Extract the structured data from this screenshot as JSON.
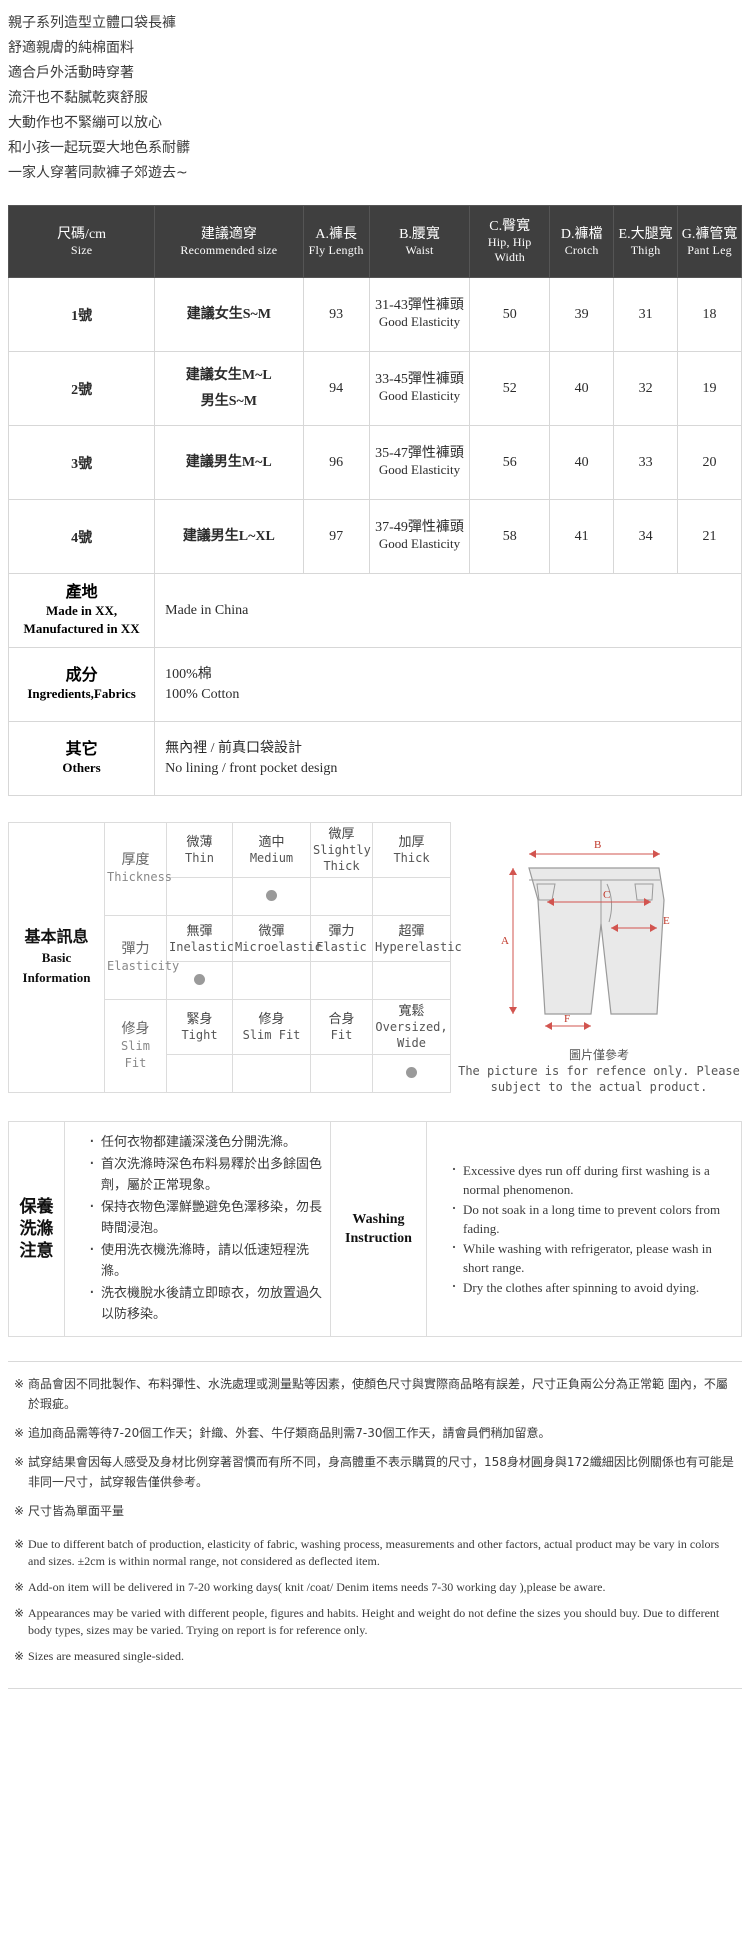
{
  "intro": {
    "lines": [
      "親子系列造型立體口袋長褲",
      "舒適親膚的純棉面料",
      "適合戶外活動時穿著",
      "流汗也不黏膩乾爽舒服",
      "大動作也不緊繃可以放心",
      "和小孩一起玩耍大地色系耐髒",
      "一家人穿著同款褲子郊遊去~"
    ]
  },
  "size_table": {
    "headers": [
      {
        "cn": "尺碼/cm",
        "en": "Size"
      },
      {
        "cn": "建議適穿",
        "en": "Recommended size"
      },
      {
        "cn": "A.褲長",
        "en": "Fly Length"
      },
      {
        "cn": "B.腰寬",
        "en": "Waist"
      },
      {
        "cn": "C.臀寬",
        "en": "Hip, Hip Width"
      },
      {
        "cn": "D.褲檔",
        "en": "Crotch"
      },
      {
        "cn": "E.大腿寬",
        "en": "Thigh"
      },
      {
        "cn": "G.褲管寬",
        "en": "Pant Leg"
      }
    ],
    "rows": [
      {
        "size": "1號",
        "recommended": [
          "建議女生S~M"
        ],
        "fly_length": "93",
        "waist_cn": "31-43彈性褲頭",
        "waist_en": "Good Elasticity",
        "hip": "50",
        "crotch": "39",
        "thigh": "31",
        "pant_leg": "18"
      },
      {
        "size": "2號",
        "recommended": [
          "建議女生M~L",
          "男生S~M"
        ],
        "fly_length": "94",
        "waist_cn": "33-45彈性褲頭",
        "waist_en": "Good Elasticity",
        "hip": "52",
        "crotch": "40",
        "thigh": "32",
        "pant_leg": "19"
      },
      {
        "size": "3號",
        "recommended": [
          "建議男生M~L"
        ],
        "fly_length": "96",
        "waist_cn": "35-47彈性褲頭",
        "waist_en": "Good Elasticity",
        "hip": "56",
        "crotch": "40",
        "thigh": "33",
        "pant_leg": "20"
      },
      {
        "size": "4號",
        "recommended": [
          "建議男生L~XL"
        ],
        "fly_length": "97",
        "waist_cn": "37-49彈性褲頭",
        "waist_en": "Good Elasticity",
        "hip": "58",
        "crotch": "41",
        "thigh": "34",
        "pant_leg": "21"
      }
    ],
    "info_rows": [
      {
        "label_cn": "產地",
        "label_en": "Made in XX, Manufactured in XX",
        "value_lines": [
          "Made in China"
        ]
      },
      {
        "label_cn": "成分",
        "label_en": "Ingredients,Fabrics",
        "value_lines": [
          "100%棉",
          "100% Cotton"
        ]
      },
      {
        "label_cn": "其它",
        "label_en": "Others",
        "value_lines": [
          "無內裡 / 前真口袋設計",
          "No lining / front pocket design"
        ]
      }
    ]
  },
  "basic_info": {
    "title_cn": "基本訊息",
    "title_en": "Basic Information",
    "rows": [
      {
        "label_cn": "厚度",
        "label_en": "Thickness",
        "options": [
          {
            "cn": "微薄",
            "en": "Thin"
          },
          {
            "cn": "適中",
            "en": "Medium"
          },
          {
            "cn": "微厚",
            "en": "Slightly Thick"
          },
          {
            "cn": "加厚",
            "en": "Thick"
          }
        ],
        "selected_index": 1
      },
      {
        "label_cn": "彈力",
        "label_en": "Elasticity",
        "options": [
          {
            "cn": "無彈",
            "en": "Inelastic"
          },
          {
            "cn": "微彈",
            "en": "Microelastic"
          },
          {
            "cn": "彈力",
            "en": "Elastic"
          },
          {
            "cn": "超彈",
            "en": "Hyperelastic"
          }
        ],
        "selected_index": 0
      },
      {
        "label_cn": "修身",
        "label_en": "Slim Fit",
        "options": [
          {
            "cn": "緊身",
            "en": "Tight"
          },
          {
            "cn": "修身",
            "en": "Slim Fit"
          },
          {
            "cn": "合身",
            "en": "Fit"
          },
          {
            "cn": "寬鬆",
            "en": "Oversized, Wide"
          }
        ],
        "selected_index": 3
      }
    ]
  },
  "diagram": {
    "markers": [
      "A",
      "B",
      "C",
      "E",
      "F"
    ],
    "caption_cn": "圖片僅參考",
    "caption_en": "The picture is for refence only. Please subject to the actual product."
  },
  "washing": {
    "label_cn": [
      "保養",
      "洗滌",
      "注意"
    ],
    "label_en": [
      "Washing",
      "Instruction"
    ],
    "items_cn": [
      "任何衣物都建議深淺色分開洗滌。",
      "首次洗滌時深色布料易釋於出多餘固色劑，屬於正常現象。",
      "保持衣物色澤鮮艷避免色澤移染，勿長時間浸泡。",
      "使用洗衣機洗滌時，請以低速短程洗滌。",
      "洗衣機脫水後請立即晾衣，勿放置過久以防移染。"
    ],
    "items_en": [
      "Excessive dyes run off during first washing is a normal phenomenon.",
      "Do not soak in a long time to prevent colors from fading.",
      "While washing with refrigerator, please wash in short range.",
      "Dry the clothes after spinning to avoid dying."
    ]
  },
  "notes": {
    "mark": "※",
    "cn": [
      "商品會因不同批製作、布料彈性、水洗處理或測量點等因素，使顏色尺寸與實際商品略有誤差，尺寸正負兩公分為正常範 圍內，不屬於瑕疵。",
      "追加商品需等待7-20個工作天；針織、外套、牛仔類商品則需7-30個工作天，請會員們稍加留意。",
      "試穿結果會因每人感受及身材比例穿著習慣而有所不同，身高體重不表示購買的尺寸，158身材圓身與172纖細因比例關係也有可能是非同一尺寸，試穿報告僅供參考。",
      "尺寸皆為單面平量"
    ],
    "en": [
      "Due to different batch of production, elasticity of fabric, washing process, measurements and other factors, actual product may be vary in colors and sizes. ±2cm is within normal range, not considered as deflected item.",
      "Add-on item will be delivered in 7-20 working days( knit /coat/ Denim items needs 7-30 working day ),please be aware.",
      "Appearances may be varied with different people, figures and habits. Height and weight do not define the sizes you should buy. Due to different body types, sizes may be varied. Trying on report is for reference only.",
      "Sizes are measured single-sided."
    ]
  }
}
